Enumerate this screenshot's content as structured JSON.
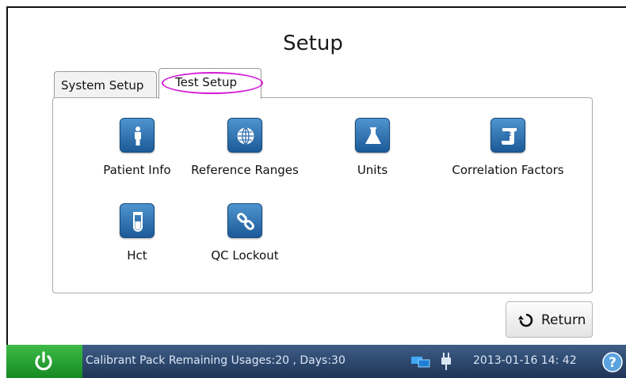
{
  "page": {
    "title": "Setup"
  },
  "tabs": [
    {
      "label": "System Setup",
      "active": false
    },
    {
      "label": "Test Setup",
      "active": true
    }
  ],
  "items": [
    {
      "label": "Patient Info",
      "icon": "person-icon"
    },
    {
      "label": "Reference Ranges",
      "icon": "globe-icon"
    },
    {
      "label": "Units",
      "icon": "flask-icon"
    },
    {
      "label": "Correlation Factors",
      "icon": "correlation-icon"
    },
    {
      "label": "Hct",
      "icon": "test-tube-icon"
    },
    {
      "label": "QC Lockout",
      "icon": "chain-link-icon"
    }
  ],
  "return_button": {
    "label": "Return",
    "icon": "return-arrow-icon"
  },
  "statusbar": {
    "power_icon": "power-icon",
    "message": "Calibrant Pack Remaining Usages:20 , Days:30",
    "network_icon": "network-icon",
    "plug_icon": "power-plug-icon",
    "datetime": "2013-01-16  14: 42",
    "help_icon": "help-icon"
  },
  "colors": {
    "accent_blue": "#2a6aad",
    "highlight_magenta": "#d41ad8",
    "power_green": "#22992e",
    "statusbar_navy": "#27406a"
  }
}
